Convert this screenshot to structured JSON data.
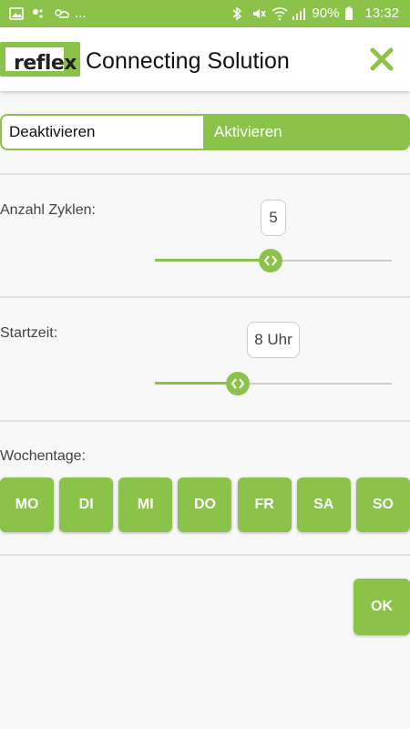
{
  "status_bar": {
    "left_icons": [
      "image-icon",
      "notification-dots-icon",
      "weather-icon"
    ],
    "more_text": "...",
    "right_icons": [
      "bluetooth-icon",
      "mute-icon",
      "wifi-icon",
      "signal-icon",
      "battery-icon"
    ],
    "battery": "90%",
    "time": "13:32"
  },
  "header": {
    "logo_text": "reflex",
    "title": "Connecting Solution",
    "close_icon": "close-icon"
  },
  "toggle": {
    "off_label": "Deaktivieren",
    "on_label": "Aktivieren",
    "selected": "Aktivieren"
  },
  "cycles": {
    "label": "Anzahl Zyklen:",
    "value": "5",
    "slider_fraction": 0.49
  },
  "start": {
    "label": "Startzeit:",
    "value": "8 Uhr",
    "slider_fraction": 0.35
  },
  "weekdays": {
    "label": "Wochentage:",
    "days": [
      "MO",
      "DI",
      "MI",
      "DO",
      "FR",
      "SA",
      "SO"
    ]
  },
  "ok_label": "OK",
  "colors": {
    "accent": "#8bc34a",
    "track": "#cccccc",
    "background": "#f8f8f8"
  }
}
